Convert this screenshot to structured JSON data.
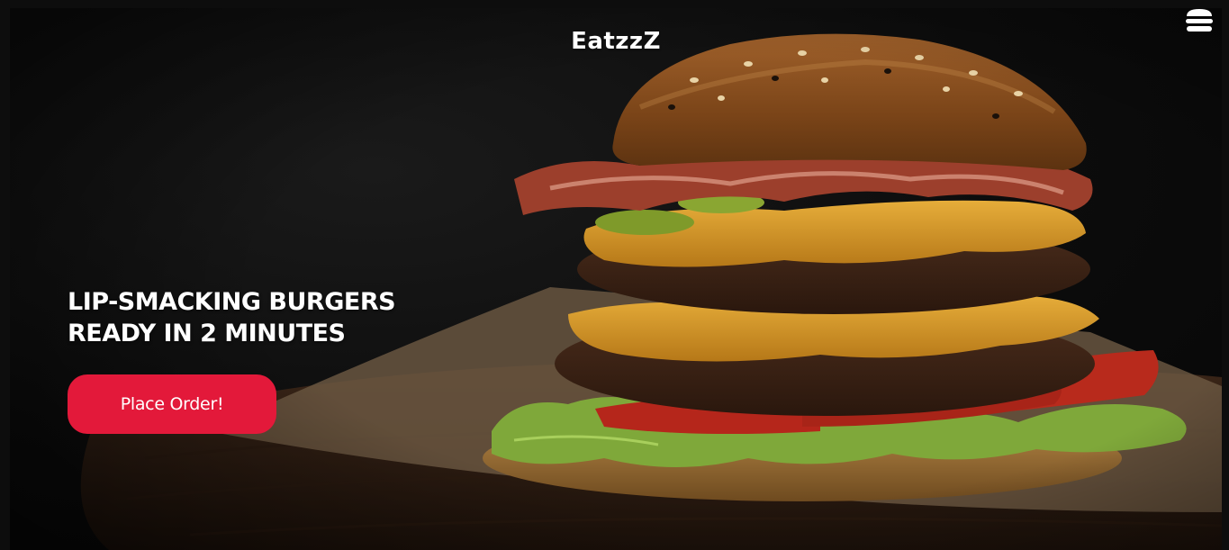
{
  "header": {
    "brand": "EatzzZ",
    "menu_icon": "burger-menu-icon"
  },
  "hero": {
    "headline_line1": "LIP-SMACKING BURGERS",
    "headline_line2": "READY IN 2 MINUTES",
    "cta_label": "Place Order!",
    "image": "burger-photo"
  },
  "colors": {
    "cta_background": "#e3193a",
    "text": "#ffffff",
    "background": "#0d0d0d"
  }
}
